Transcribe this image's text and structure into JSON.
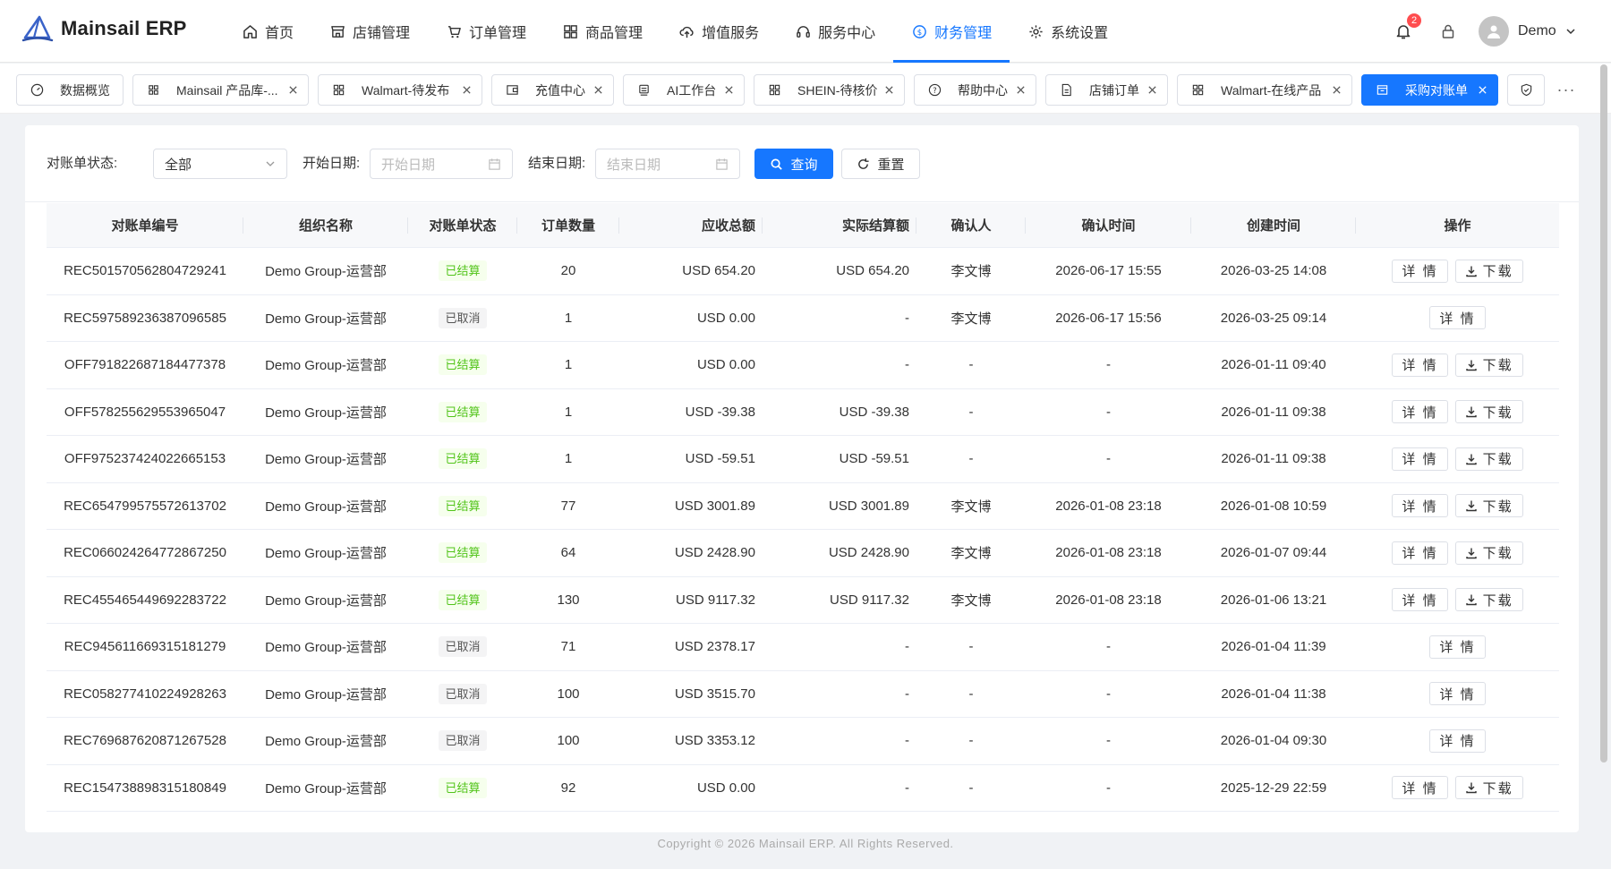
{
  "app": {
    "name": "Mainsail ERP",
    "colors": {
      "primary": "#1677ff",
      "success": "#52c41a",
      "badge": "#ff4d4f"
    }
  },
  "nav": {
    "items": [
      {
        "label": "首页",
        "icon": "home-icon"
      },
      {
        "label": "店铺管理",
        "icon": "shop-icon"
      },
      {
        "label": "订单管理",
        "icon": "cart-icon"
      },
      {
        "label": "商品管理",
        "icon": "grid-icon"
      },
      {
        "label": "增值服务",
        "icon": "cloud-upload-icon"
      },
      {
        "label": "服务中心",
        "icon": "headset-icon"
      },
      {
        "label": "财务管理",
        "icon": "dollar-circle-icon",
        "active": true
      },
      {
        "label": "系统设置",
        "icon": "gear-icon"
      }
    ]
  },
  "header": {
    "notifications": "2",
    "user": "Demo"
  },
  "tabs": [
    {
      "label": "数据概览",
      "icon": "dashboard-icon",
      "closable": false
    },
    {
      "label": "Mainsail 产品库-...",
      "icon": "apps-icon",
      "closable": true
    },
    {
      "label": "Walmart-待发布",
      "icon": "grid-icon",
      "closable": true
    },
    {
      "label": "充值中心",
      "icon": "wallet-icon",
      "closable": true
    },
    {
      "label": "AI工作台",
      "icon": "robot-icon",
      "closable": true
    },
    {
      "label": "SHEIN-待核价",
      "icon": "grid-icon",
      "closable": true
    },
    {
      "label": "帮助中心",
      "icon": "question-icon",
      "closable": true
    },
    {
      "label": "店铺订单",
      "icon": "file-icon",
      "closable": true
    },
    {
      "label": "Walmart-在线产品",
      "icon": "grid-icon",
      "closable": true
    },
    {
      "label": "采购对账单",
      "icon": "reconcile-icon",
      "closable": true,
      "active": true
    }
  ],
  "tabs_more": "···",
  "filter": {
    "status_label": "对账单状态:",
    "status_value": "全部",
    "start_label": "开始日期:",
    "start_placeholder": "开始日期",
    "end_label": "结束日期:",
    "end_placeholder": "结束日期",
    "search_button": "查询",
    "reset_button": "重置"
  },
  "table": {
    "columns": [
      "对账单编号",
      "组织名称",
      "对账单状态",
      "订单数量",
      "应收总额",
      "实际结算额",
      "确认人",
      "确认时间",
      "创建时间",
      "操作"
    ],
    "action_detail": "详 情",
    "action_download": "下载",
    "rows": [
      {
        "id": "REC501570562804729241",
        "org": "Demo Group-运营部",
        "status": "已结算",
        "qty": "20",
        "receivable": "USD 654.20",
        "settled": "USD 654.20",
        "confirmer": "李文博",
        "confirmed_at": "2026-06-17 15:55",
        "created_at": "2026-03-25 14:08",
        "download": true
      },
      {
        "id": "REC597589236387096585",
        "org": "Demo Group-运营部",
        "status": "已取消",
        "qty": "1",
        "receivable": "USD 0.00",
        "settled": "-",
        "confirmer": "李文博",
        "confirmed_at": "2026-06-17 15:56",
        "created_at": "2026-03-25 09:14",
        "download": false
      },
      {
        "id": "OFF791822687184477378",
        "org": "Demo Group-运营部",
        "status": "已结算",
        "qty": "1",
        "receivable": "USD 0.00",
        "settled": "-",
        "confirmer": "-",
        "confirmed_at": "-",
        "created_at": "2026-01-11 09:40",
        "download": true
      },
      {
        "id": "OFF578255629553965047",
        "org": "Demo Group-运营部",
        "status": "已结算",
        "qty": "1",
        "receivable": "USD -39.38",
        "settled": "USD -39.38",
        "confirmer": "-",
        "confirmed_at": "-",
        "created_at": "2026-01-11 09:38",
        "download": true
      },
      {
        "id": "OFF975237424022665153",
        "org": "Demo Group-运营部",
        "status": "已结算",
        "qty": "1",
        "receivable": "USD -59.51",
        "settled": "USD -59.51",
        "confirmer": "-",
        "confirmed_at": "-",
        "created_at": "2026-01-11 09:38",
        "download": true
      },
      {
        "id": "REC654799575572613702",
        "org": "Demo Group-运营部",
        "status": "已结算",
        "qty": "77",
        "receivable": "USD 3001.89",
        "settled": "USD 3001.89",
        "confirmer": "李文博",
        "confirmed_at": "2026-01-08 23:18",
        "created_at": "2026-01-08 10:59",
        "download": true
      },
      {
        "id": "REC066024264772867250",
        "org": "Demo Group-运营部",
        "status": "已结算",
        "qty": "64",
        "receivable": "USD 2428.90",
        "settled": "USD 2428.90",
        "confirmer": "李文博",
        "confirmed_at": "2026-01-08 23:18",
        "created_at": "2026-01-07 09:44",
        "download": true
      },
      {
        "id": "REC455465449692283722",
        "org": "Demo Group-运营部",
        "status": "已结算",
        "qty": "130",
        "receivable": "USD 9117.32",
        "settled": "USD 9117.32",
        "confirmer": "李文博",
        "confirmed_at": "2026-01-08 23:18",
        "created_at": "2026-01-06 13:21",
        "download": true
      },
      {
        "id": "REC945611669315181279",
        "org": "Demo Group-运营部",
        "status": "已取消",
        "qty": "71",
        "receivable": "USD 2378.17",
        "settled": "-",
        "confirmer": "-",
        "confirmed_at": "-",
        "created_at": "2026-01-04 11:39",
        "download": false
      },
      {
        "id": "REC058277410224928263",
        "org": "Demo Group-运营部",
        "status": "已取消",
        "qty": "100",
        "receivable": "USD 3515.70",
        "settled": "-",
        "confirmer": "-",
        "confirmed_at": "-",
        "created_at": "2026-01-04 11:38",
        "download": false
      },
      {
        "id": "REC769687620871267528",
        "org": "Demo Group-运营部",
        "status": "已取消",
        "qty": "100",
        "receivable": "USD 3353.12",
        "settled": "-",
        "confirmer": "-",
        "confirmed_at": "-",
        "created_at": "2026-01-04 09:30",
        "download": false
      },
      {
        "id": "REC154738898315180849",
        "org": "Demo Group-运营部",
        "status": "已结算",
        "qty": "92",
        "receivable": "USD 0.00",
        "settled": "-",
        "confirmer": "-",
        "confirmed_at": "-",
        "created_at": "2025-12-29 22:59",
        "download": true
      }
    ]
  },
  "footer": "Copyright © 2026 Mainsail ERP. All Rights Reserved."
}
